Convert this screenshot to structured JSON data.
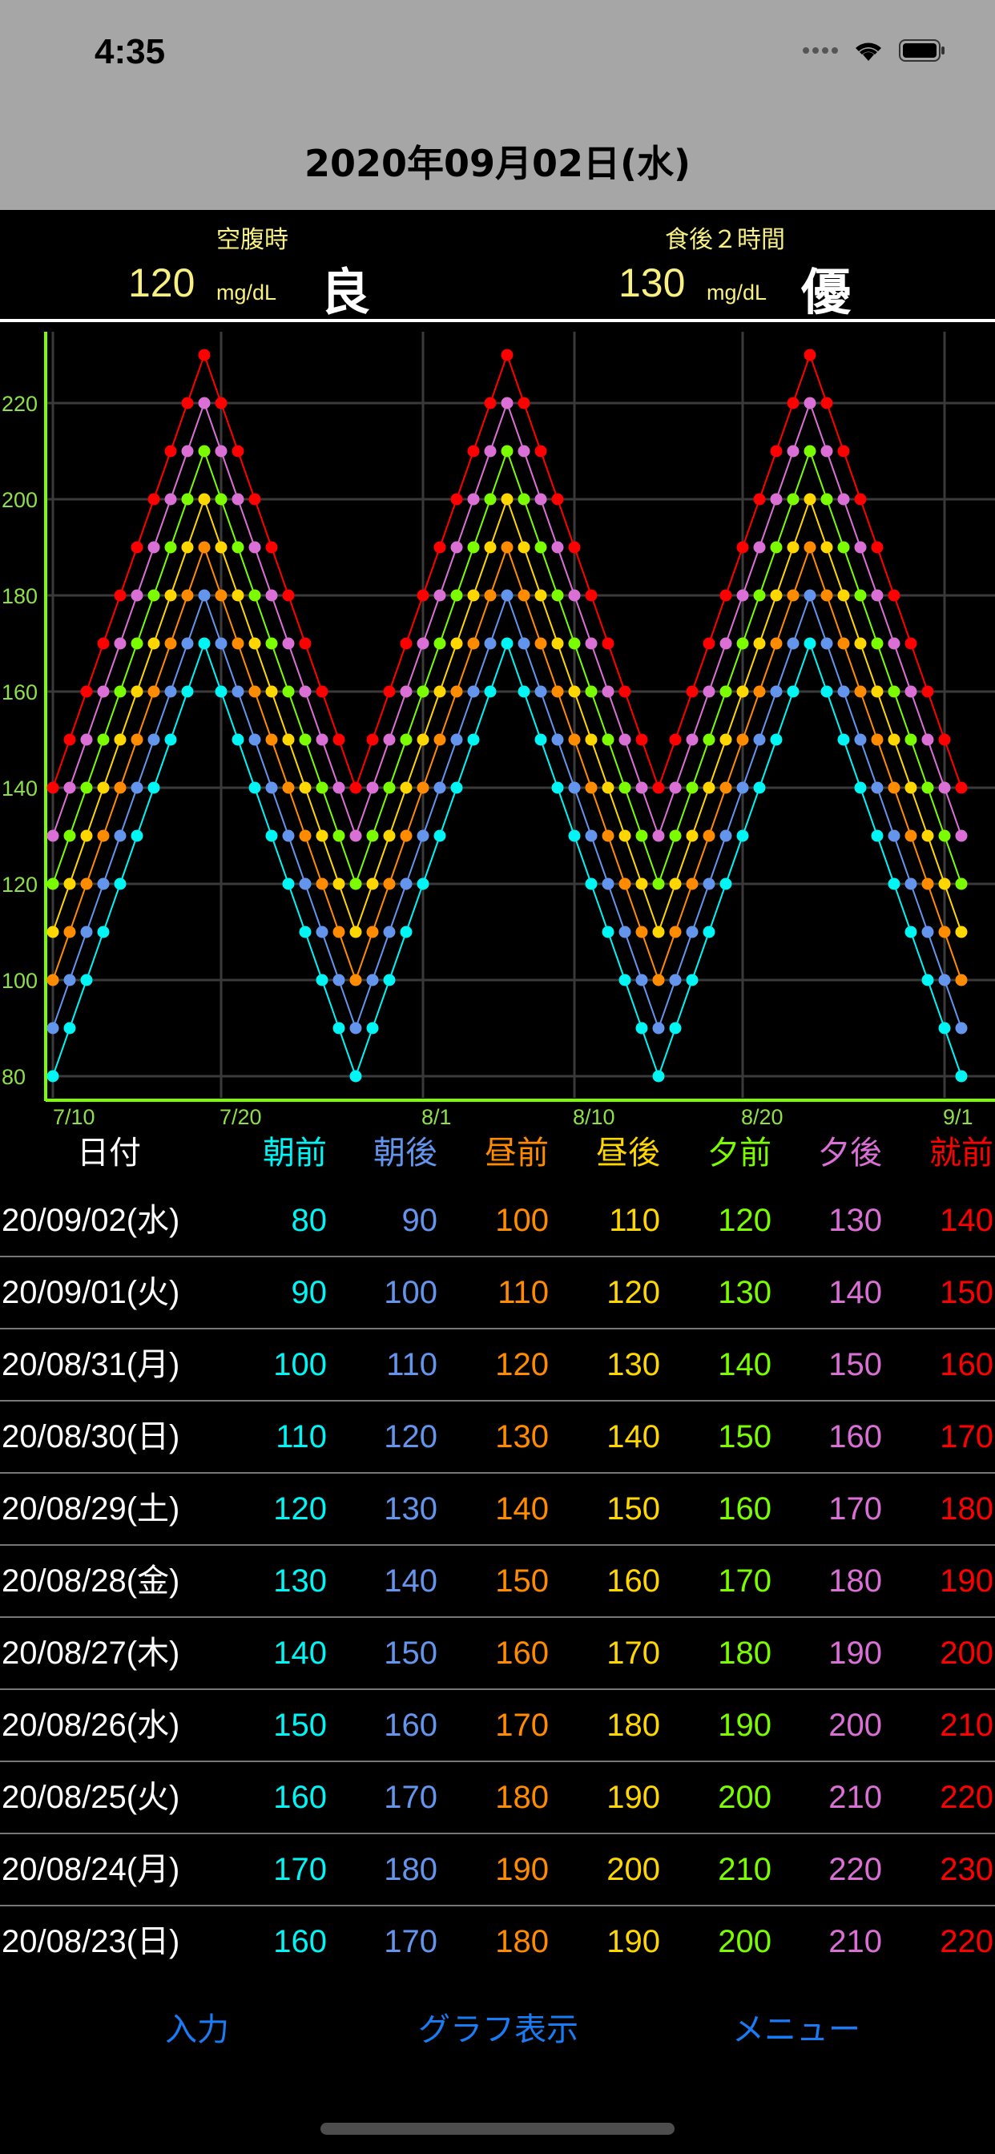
{
  "status_bar": {
    "time": "4:35"
  },
  "header": {
    "title": "2020年09月02日(水)"
  },
  "summary": {
    "fasting": {
      "label": "空腹時",
      "value": "120",
      "unit": "mg/dL",
      "grade": "良"
    },
    "postprandial": {
      "label": "食後２時間",
      "value": "130",
      "unit": "mg/dL",
      "grade": "優"
    }
  },
  "chart_data": {
    "type": "line",
    "x": [
      "7/10",
      "7/11",
      "7/12",
      "7/13",
      "7/14",
      "7/15",
      "7/16",
      "7/17",
      "7/18",
      "7/19",
      "7/20",
      "7/21",
      "7/22",
      "7/23",
      "7/24",
      "7/25",
      "7/26",
      "7/27",
      "7/28",
      "7/29",
      "7/30",
      "7/31",
      "8/1",
      "8/2",
      "8/3",
      "8/4",
      "8/5",
      "8/6",
      "8/7",
      "8/8",
      "8/9",
      "8/10",
      "8/11",
      "8/12",
      "8/13",
      "8/14",
      "8/15",
      "8/16",
      "8/17",
      "8/18",
      "8/19",
      "8/20",
      "8/21",
      "8/22",
      "8/23",
      "8/24",
      "8/25",
      "8/26",
      "8/27",
      "8/28",
      "8/29",
      "8/30",
      "8/31",
      "9/1",
      "9/2"
    ],
    "x_ticks": [
      "7/10",
      "7/20",
      "8/1",
      "8/10",
      "8/20",
      "9/1"
    ],
    "y_ticks": [
      80,
      100,
      120,
      140,
      160,
      180,
      200,
      220
    ],
    "ylim": [
      72,
      235
    ],
    "grid": true,
    "series": [
      {
        "color": "#00f5f5",
        "values": [
          80,
          90,
          100,
          110,
          120,
          130,
          140,
          150,
          160,
          170,
          160,
          150,
          140,
          130,
          120,
          110,
          100,
          90,
          80,
          90,
          100,
          110,
          120,
          130,
          140,
          150,
          160,
          170,
          160,
          150,
          140,
          130,
          120,
          110,
          100,
          90,
          80,
          90,
          100,
          110,
          120,
          130,
          140,
          150,
          160,
          170,
          160,
          150,
          140,
          130,
          120,
          110,
          100,
          90,
          80
        ]
      },
      {
        "color": "#6495ed",
        "values": [
          90,
          100,
          110,
          120,
          130,
          140,
          150,
          160,
          170,
          180,
          170,
          160,
          150,
          140,
          130,
          120,
          110,
          100,
          90,
          100,
          110,
          120,
          130,
          140,
          150,
          160,
          170,
          180,
          170,
          160,
          150,
          140,
          130,
          120,
          110,
          100,
          90,
          100,
          110,
          120,
          130,
          140,
          150,
          160,
          170,
          180,
          170,
          160,
          150,
          140,
          130,
          120,
          110,
          100,
          90
        ]
      },
      {
        "color": "#ff8c00",
        "values": [
          100,
          110,
          120,
          130,
          140,
          150,
          160,
          170,
          180,
          190,
          180,
          170,
          160,
          150,
          140,
          130,
          120,
          110,
          100,
          110,
          120,
          130,
          140,
          150,
          160,
          170,
          180,
          190,
          180,
          170,
          160,
          150,
          140,
          130,
          120,
          110,
          100,
          110,
          120,
          130,
          140,
          150,
          160,
          170,
          180,
          190,
          180,
          170,
          160,
          150,
          140,
          130,
          120,
          110,
          100
        ]
      },
      {
        "color": "#ffd700",
        "values": [
          110,
          120,
          130,
          140,
          150,
          160,
          170,
          180,
          190,
          200,
          190,
          180,
          170,
          160,
          150,
          140,
          130,
          120,
          110,
          120,
          130,
          140,
          150,
          160,
          170,
          180,
          190,
          200,
          190,
          180,
          170,
          160,
          150,
          140,
          130,
          120,
          110,
          120,
          130,
          140,
          150,
          160,
          170,
          180,
          190,
          200,
          190,
          180,
          170,
          160,
          150,
          140,
          130,
          120,
          110
        ]
      },
      {
        "color": "#7cfc00",
        "values": [
          120,
          130,
          140,
          150,
          160,
          170,
          180,
          190,
          200,
          210,
          200,
          190,
          180,
          170,
          160,
          150,
          140,
          130,
          120,
          130,
          140,
          150,
          160,
          170,
          180,
          190,
          200,
          210,
          200,
          190,
          180,
          170,
          160,
          150,
          140,
          130,
          120,
          130,
          140,
          150,
          160,
          170,
          180,
          190,
          200,
          210,
          200,
          190,
          180,
          170,
          160,
          150,
          140,
          130,
          120
        ]
      },
      {
        "color": "#da70d6",
        "values": [
          130,
          140,
          150,
          160,
          170,
          180,
          190,
          200,
          210,
          220,
          210,
          200,
          190,
          180,
          170,
          160,
          150,
          140,
          130,
          140,
          150,
          160,
          170,
          180,
          190,
          200,
          210,
          220,
          210,
          200,
          190,
          180,
          170,
          160,
          150,
          140,
          130,
          140,
          150,
          160,
          170,
          180,
          190,
          200,
          210,
          220,
          210,
          200,
          190,
          180,
          170,
          160,
          150,
          140,
          130
        ]
      },
      {
        "color": "#ff0000",
        "values": [
          140,
          150,
          160,
          170,
          180,
          190,
          200,
          210,
          220,
          230,
          220,
          210,
          200,
          190,
          180,
          170,
          160,
          150,
          140,
          150,
          160,
          170,
          180,
          190,
          200,
          210,
          220,
          230,
          220,
          210,
          200,
          190,
          180,
          170,
          160,
          150,
          140,
          150,
          160,
          170,
          180,
          190,
          200,
          210,
          220,
          230,
          220,
          210,
          200,
          190,
          180,
          170,
          160,
          150,
          140
        ]
      }
    ],
    "axis_color": "#7cfc00"
  },
  "table": {
    "headers": [
      "日付",
      "朝前",
      "朝後",
      "昼前",
      "昼後",
      "夕前",
      "夕後",
      "就前"
    ],
    "header_colors": [
      "#ffffff",
      "#00f5f5",
      "#6495ed",
      "#ff8c00",
      "#ffd700",
      "#7cfc00",
      "#da70d6",
      "#ff0000"
    ],
    "rows": [
      [
        "20/09/02(水)",
        "80",
        "90",
        "100",
        "110",
        "120",
        "130",
        "140"
      ],
      [
        "20/09/01(火)",
        "90",
        "100",
        "110",
        "120",
        "130",
        "140",
        "150"
      ],
      [
        "20/08/31(月)",
        "100",
        "110",
        "120",
        "130",
        "140",
        "150",
        "160"
      ],
      [
        "20/08/30(日)",
        "110",
        "120",
        "130",
        "140",
        "150",
        "160",
        "170"
      ],
      [
        "20/08/29(土)",
        "120",
        "130",
        "140",
        "150",
        "160",
        "170",
        "180"
      ],
      [
        "20/08/28(金)",
        "130",
        "140",
        "150",
        "160",
        "170",
        "180",
        "190"
      ],
      [
        "20/08/27(木)",
        "140",
        "150",
        "160",
        "170",
        "180",
        "190",
        "200"
      ],
      [
        "20/08/26(水)",
        "150",
        "160",
        "170",
        "180",
        "190",
        "200",
        "210"
      ],
      [
        "20/08/25(火)",
        "160",
        "170",
        "180",
        "190",
        "200",
        "210",
        "220"
      ],
      [
        "20/08/24(月)",
        "170",
        "180",
        "190",
        "200",
        "210",
        "220",
        "230"
      ],
      [
        "20/08/23(日)",
        "160",
        "170",
        "180",
        "190",
        "200",
        "210",
        "220"
      ]
    ]
  },
  "toolbar": {
    "input": "入力",
    "graph": "グラフ表示",
    "menu": "メニュー"
  }
}
